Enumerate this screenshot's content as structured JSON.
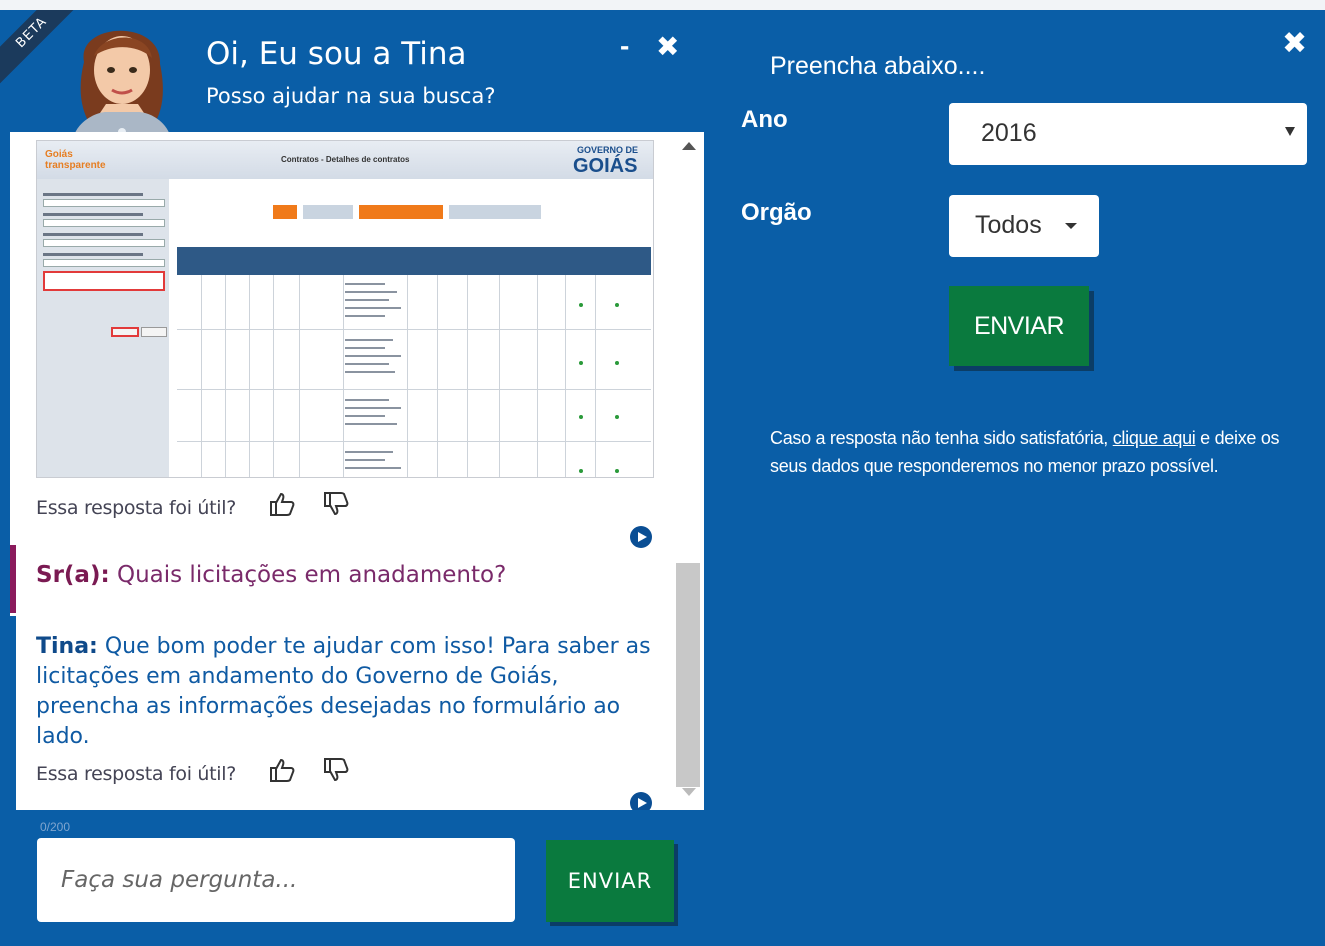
{
  "chat": {
    "beta_label": "BETA",
    "title": "Oi, Eu sou a Tina",
    "subtitle": "Posso ajudar na sua busca?",
    "minimize_label": "-",
    "close_label": "✖",
    "embedded_screenshot": {
      "logo_text": "Goiás",
      "logo_sub": "transparente",
      "page_title": "Contratos - Detalhes de contratos",
      "brand_small": "GOVERNO DE",
      "brand": "GOIÁS"
    },
    "feedback_prompt": "Essa resposta foi útil?",
    "user_message": {
      "speaker": "Sr(a):",
      "text": " Quais licitações em anadamento?"
    },
    "tina_message": {
      "speaker": "Tina:",
      "text": " Que bom poder te ajudar com isso! Para saber as licitações em andamento do Governo de Goiás, preencha as informações desejadas no formulário ao lado."
    },
    "char_counter": "0/200",
    "input_placeholder": "Faça sua pergunta...",
    "send_label": "ENVIAR"
  },
  "form": {
    "close_label": "✖",
    "heading": "Preencha abaixo....",
    "ano_label": "Ano",
    "ano_value": "2016",
    "orgao_label": "Orgão",
    "orgao_value": "Todos",
    "send_label": "ENVIAR",
    "note_before_link": "Caso a resposta não tenha sido satisfatória, ",
    "note_link": "clique aqui",
    "note_after_link": " e deixe os seus dados que responderemos no menor prazo possível."
  },
  "colors": {
    "panel_blue": "#0a5ea7",
    "send_green": "#0a7a3e",
    "user_purple": "#7a1a52",
    "tina_blue": "#0f5aa3"
  },
  "icons": [
    "minimize-icon",
    "close-icon",
    "thumbs-up-icon",
    "thumbs-down-icon",
    "play-icon",
    "dropdown-caret-icon"
  ]
}
